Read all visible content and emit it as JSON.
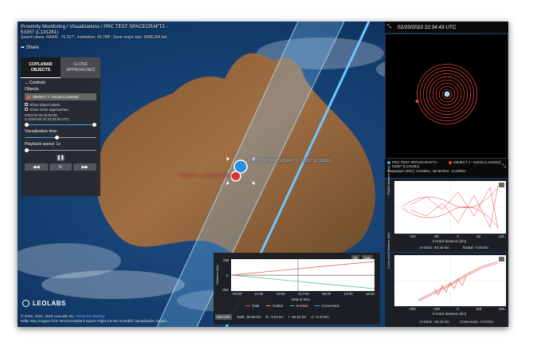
{
  "header": {
    "title": "Proximity Monitoring / Visualizations / PRC TEST SPACECRAFT2 - 53357 (L131281)",
    "subtitle": "Search plane: RAAN: -76.267°, Inclination: 49.788°, Semi-major axis: 6988.204 km",
    "share_label": "Share"
  },
  "tabs": [
    {
      "label": "COPLANAR OBJECTS",
      "active": true
    },
    {
      "label": "CLOSE APPROACHES",
      "active": false
    }
  ],
  "controls": {
    "section_label": "Controls",
    "objects_label": "Objects",
    "selected_object": "OBJECT J - 54218 (L132634)",
    "selected_color": "#e45a46",
    "show_labels": "Show object labels",
    "show_close": "Show close approaches",
    "date_start": "2023-02-19 22:34:00",
    "date_end": "to 2023-02-21 22:33:00 UTC",
    "date_range_fraction": 1.0,
    "viz_time_label": "Visualization time",
    "viz_time_fraction": 0.45,
    "playback_label": "Playback speed: 1x",
    "playback_fraction": 0.0,
    "pause_icon": "pause-icon",
    "rewind_icon": "rewind-icon",
    "reset_icon": "reset-icon",
    "forward_icon": "fast-forward-icon"
  },
  "globe": {
    "spacecraft_label": "PRC TEST SPACECRAFT2 - 53357 (L131281)",
    "object_label": "OBJECT J - 54218 (L132634)"
  },
  "footer": {
    "logo": "LEOLABS",
    "copyright": "© 2016, 2022, 2023 LeoLabs Inc.",
    "terms": "Terms for sharing.",
    "credit": "Milky Way images from NASA/Goddard Space Flight Center Scientific Visualization Studio"
  },
  "right": {
    "datetime": "02/20/2023 22:34:43 UTC",
    "legend_a": "PRC TEST SPACECRAFT2 - 53357 (L131281)",
    "legend_b": "OBJECT J - 54218 (L132634)",
    "separation": "Separation (RIC): 0.043km, -66.807km, -0.429km",
    "plot1": {
      "ylabel": "Radial distance (km)",
      "xlabel": "In-track distance (km)",
      "ticks_x": [
        "-100",
        "-50",
        "0",
        "50",
        "100"
      ],
      "foot_a": "In-track: -53.44 km",
      "foot_b": "Radial: -0.05 km"
    },
    "plot2": {
      "ylabel": "Cross-track distance (km)",
      "xlabel": "In-track distance (km)",
      "ticks_x": [
        "-200",
        "-100",
        "0",
        "100",
        "200"
      ],
      "foot_a": "In-track: -53.44 km",
      "foot_b": "Cross-track: -0.43 km"
    }
  },
  "timechart": {
    "ylabel": "Distance (km)",
    "xlabel": "Date & time",
    "ytick_top": "250",
    "ytick_mid": "0",
    "ytick_bot": "-250",
    "xticks": [
      "06:00",
      "12:00",
      "18:00",
      "21 Feb",
      "06:00",
      "12:00",
      "18:00"
    ],
    "btn_2d": "2D",
    "btn_hide": "Hide",
    "legend": [
      "Total",
      "Radial",
      "In-track",
      "Cross-track"
    ],
    "legend_colors": [
      "#e84a4a",
      "#f0a04a",
      "#40c080",
      "#4a90e0"
    ],
    "csv": "Get CSV",
    "foot_total": "Total: -66.85 km",
    "foot_r": "R: -0.04 km",
    "foot_i": "I: -66.83 km",
    "foot_c": "C: -0.43 km"
  }
}
